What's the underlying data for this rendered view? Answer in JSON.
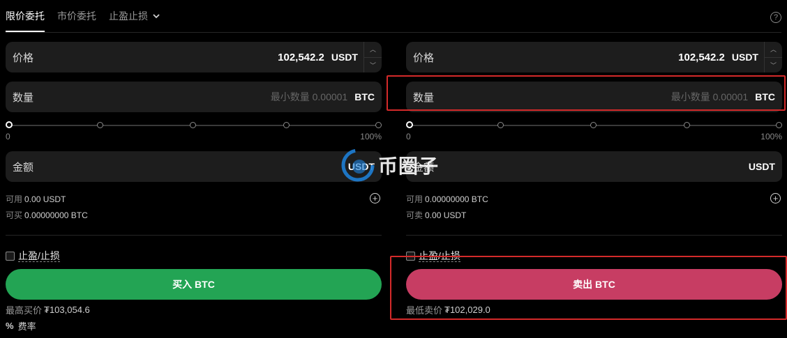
{
  "tabs": [
    {
      "label": "限价委托"
    },
    {
      "label": "市价委托"
    },
    {
      "label": "止盈止损"
    }
  ],
  "buy": {
    "price_label": "价格",
    "price_value": "102,542.2",
    "price_unit": "USDT",
    "qty_label": "数量",
    "qty_placeholder": "最小数量 0.00001",
    "qty_unit": "BTC",
    "slider_min": "0",
    "slider_max": "100%",
    "slider_value": 0,
    "amount_label": "金额",
    "amount_unit": "USDT",
    "avail_key": "可用",
    "avail_value": "0.00 USDT",
    "can_key": "可买",
    "can_value": "0.00000000 BTC",
    "tpsl_label": "止盈/止损",
    "button_label": "买入 BTC",
    "best_key": "最高买价",
    "best_value": "₮103,054.6"
  },
  "sell": {
    "price_label": "价格",
    "price_value": "102,542.2",
    "price_unit": "USDT",
    "qty_label": "数量",
    "qty_placeholder": "最小数量 0.00001",
    "qty_unit": "BTC",
    "slider_min": "0",
    "slider_max": "100%",
    "slider_value": 0,
    "amount_label": "金额",
    "amount_unit": "USDT",
    "avail_key": "可用",
    "avail_value": "0.00000000 BTC",
    "can_key": "可卖",
    "can_value": "0.00 USDT",
    "tpsl_label": "止盈/止损",
    "button_label": "卖出 BTC",
    "best_key": "最低卖价",
    "best_value": "₮102,029.0"
  },
  "fee": {
    "icon": "%",
    "label": "费率"
  },
  "watermark": {
    "text": "币圈子"
  },
  "colors": {
    "buy": "#23a454",
    "sell": "#c73d63",
    "highlight": "#d42a2a",
    "background": "#000000"
  }
}
